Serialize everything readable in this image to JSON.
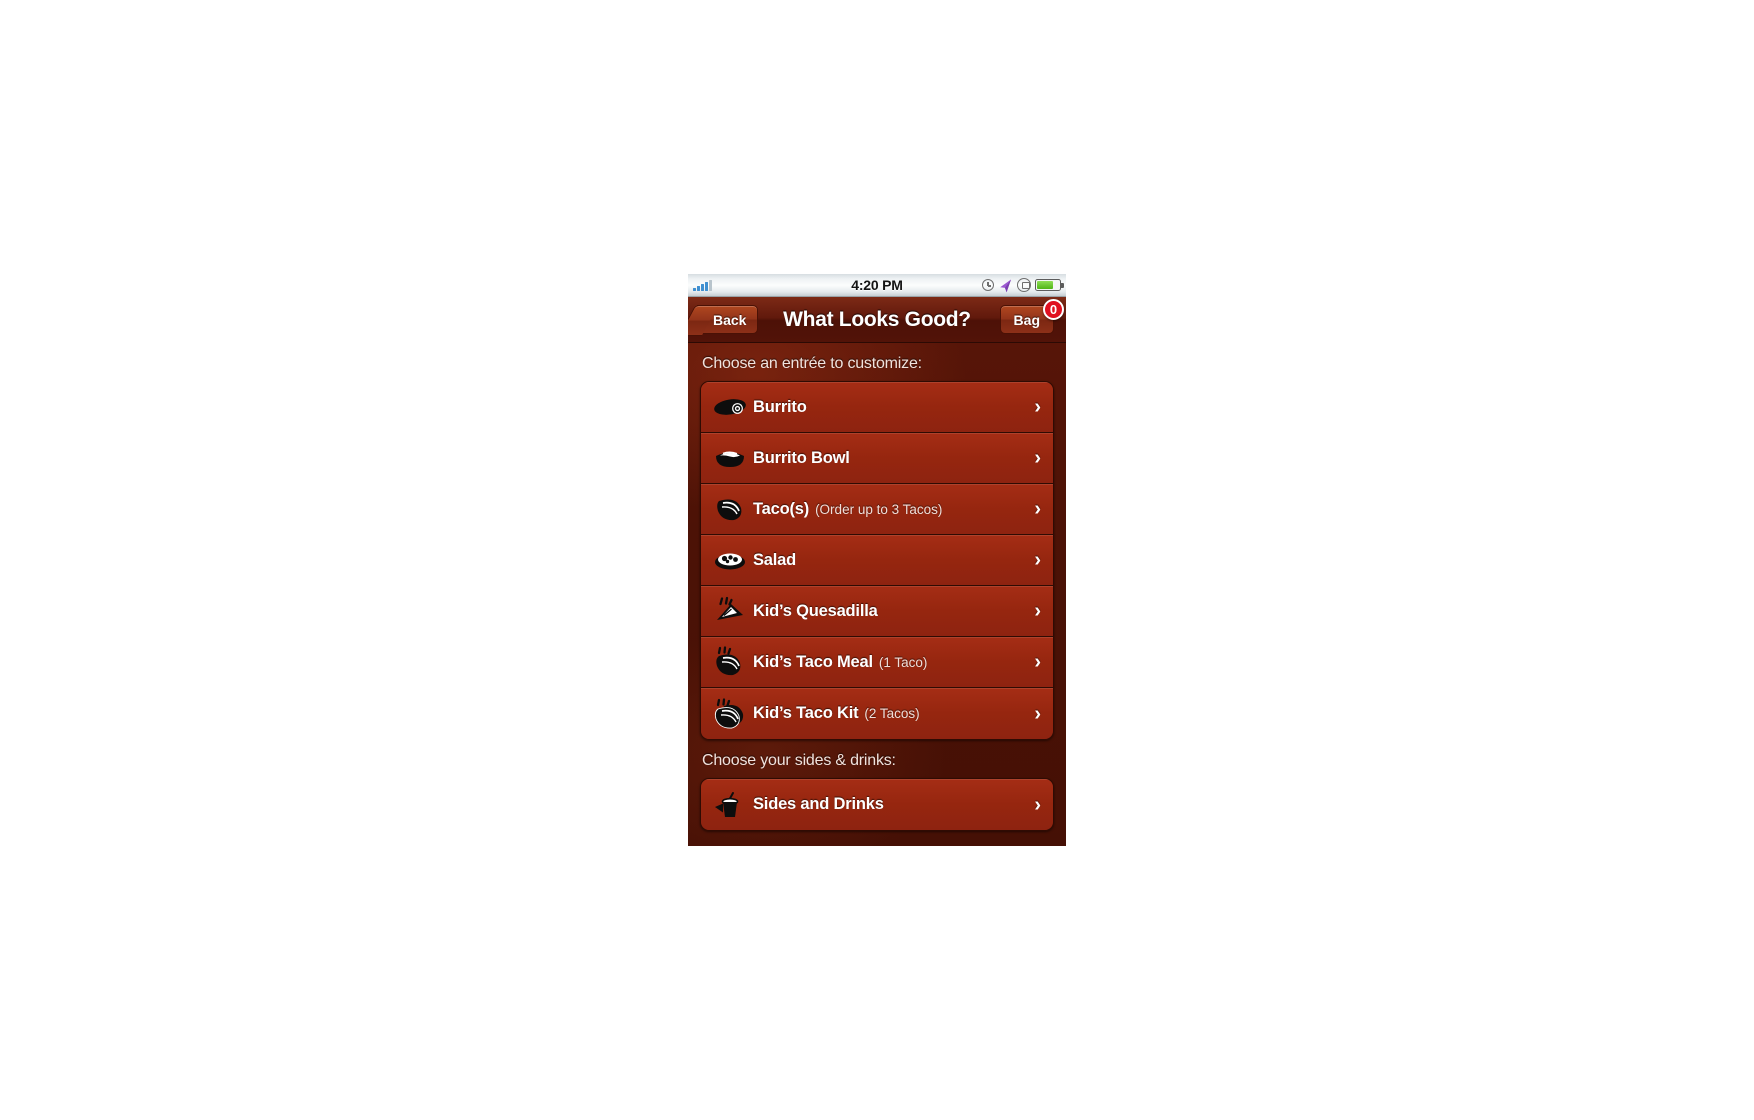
{
  "statusbar": {
    "time": "4:20 PM",
    "signal_bars": 5,
    "signal_active": 4,
    "icons": [
      "clock-icon",
      "location-arrow-icon",
      "rotation-lock-icon",
      "battery-icon"
    ],
    "battery_level": "72%"
  },
  "navbar": {
    "back_label": "Back",
    "title": "What Looks Good?",
    "bag_label": "Bag",
    "bag_count": "0",
    "badge_color": "#e01020"
  },
  "content": {
    "entree_section_label": "Choose an entrée to customize:",
    "sides_section_label": "Choose your sides & drinks:",
    "entrees": [
      {
        "icon": "burrito-icon",
        "label": "Burrito",
        "sub": ""
      },
      {
        "icon": "burrito-bowl-icon",
        "label": "Burrito Bowl",
        "sub": ""
      },
      {
        "icon": "taco-icon",
        "label": "Taco(s)",
        "sub": "(Order up to 3 Tacos)"
      },
      {
        "icon": "salad-icon",
        "label": "Salad",
        "sub": ""
      },
      {
        "icon": "quesadilla-icon",
        "label": "Kid’s Quesadilla",
        "sub": ""
      },
      {
        "icon": "kids-taco-meal-icon",
        "label": "Kid’s Taco Meal",
        "sub": "(1 Taco)"
      },
      {
        "icon": "kids-taco-kit-icon",
        "label": "Kid’s Taco Kit",
        "sub": "(2 Tacos)"
      }
    ],
    "sides": [
      {
        "icon": "drink-cup-icon",
        "label": "Sides and Drinks",
        "sub": ""
      }
    ],
    "chevron": "›"
  },
  "colors": {
    "row_red": "#96260f",
    "background_red": "#4c1206",
    "navbar_brown": "#61190c",
    "accent_white": "#ffffff"
  }
}
